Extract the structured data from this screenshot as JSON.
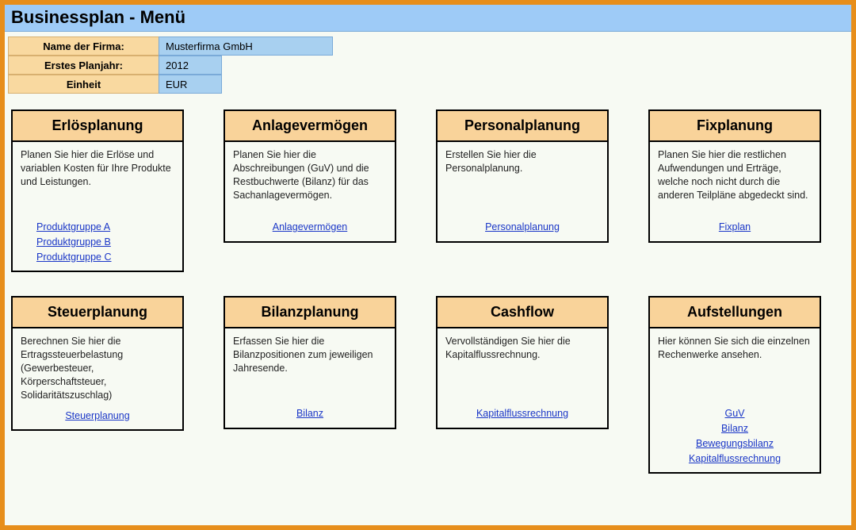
{
  "title": "Businessplan - Menü",
  "meta": {
    "firma_label": "Name der Firma:",
    "firma_value": "Musterfirma GmbH",
    "jahr_label": "Erstes Planjahr:",
    "jahr_value": "2012",
    "einheit_label": "Einheit",
    "einheit_value": "EUR"
  },
  "cards_top": [
    {
      "title": "Erlösplanung",
      "body": "Planen Sie hier die Erlöse und variablen Kosten für Ihre Produkte und Leistungen.",
      "links_align": "left",
      "links": [
        "Produktgruppe A",
        "Produktgruppe B",
        "Produktgruppe C"
      ]
    },
    {
      "title": "Anlagevermögen",
      "body": "Planen Sie hier die Abschreibungen (GuV) und die Restbuchwerte (Bilanz) für das Sachanlagevermögen.",
      "links_align": "center",
      "links": [
        "Anlagevermögen"
      ]
    },
    {
      "title": "Personalplanung",
      "body": "Erstellen Sie hier die Personalplanung.",
      "links_align": "center",
      "links": [
        "Personalplanung"
      ]
    },
    {
      "title": "Fixplanung",
      "body": "Planen Sie hier die restlichen Aufwendungen und Erträge, welche noch nicht durch die anderen Teilpläne abgedeckt sind.",
      "links_align": "center",
      "links": [
        "Fixplan"
      ]
    }
  ],
  "cards_bottom": [
    {
      "title": "Steuerplanung",
      "body": "Berechnen Sie hier die Ertragssteuerbelastung (Gewerbesteuer, Körperschaftsteuer, Solidaritätszuschlag)",
      "links_align": "center",
      "links": [
        "Steuerplanung"
      ]
    },
    {
      "title": "Bilanzplanung",
      "body": "Erfassen Sie hier die Bilanzpositionen zum jeweiligen Jahresende.",
      "links_align": "center",
      "links": [
        "Bilanz"
      ]
    },
    {
      "title": "Cashflow",
      "body": "Vervollständigen Sie hier die Kapitalflussrechnung.",
      "links_align": "center",
      "links": [
        "Kapitalflussrechnung"
      ]
    },
    {
      "title": "Aufstellungen",
      "body": "Hier können Sie sich die einzelnen Rechenwerke ansehen.",
      "links_align": "center",
      "links": [
        "GuV",
        "Bilanz",
        "Bewegungsbilanz",
        "Kapitalflussrechnung"
      ]
    }
  ]
}
